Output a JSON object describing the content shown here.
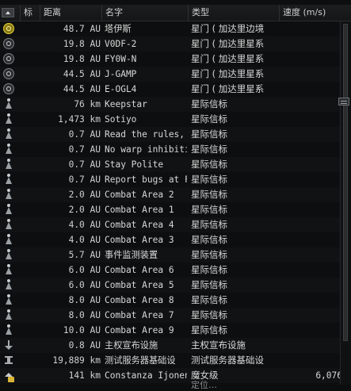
{
  "columns": {
    "icon": "标",
    "distance": "距离",
    "name": "名字",
    "type": "类型",
    "speed": "速度 (m/s)"
  },
  "rows": [
    {
      "icon": "gate-active-icon",
      "distance": "48.7 AU",
      "name": "塔伊斯",
      "type": "星门 ( 加达里边境",
      "speed": ""
    },
    {
      "icon": "gate-icon",
      "distance": "19.8 AU",
      "name": "V0DF-2",
      "type": "星门 ( 加达里星系",
      "speed": ""
    },
    {
      "icon": "gate-icon",
      "distance": "19.8 AU",
      "name": "FY0W-N",
      "type": "星门 ( 加达里星系",
      "speed": ""
    },
    {
      "icon": "gate-icon",
      "distance": "44.5 AU",
      "name": "J-GAMP",
      "type": "星门 ( 加达里星系",
      "speed": ""
    },
    {
      "icon": "gate-icon",
      "distance": "44.5 AU",
      "name": "E-OGL4",
      "type": "星门 ( 加达里星系",
      "speed": ""
    },
    {
      "icon": "beacon-icon",
      "distance": "76 km",
      "name": "Keepstar",
      "type": "星际信标",
      "speed": ""
    },
    {
      "icon": "beacon-icon",
      "distance": "1,473 km",
      "name": "Sotiyo",
      "type": "星际信标",
      "speed": ""
    },
    {
      "icon": "beacon-icon",
      "distance": "0.7 AU",
      "name": "Read the rules, t",
      "type": "星际信标",
      "speed": ""
    },
    {
      "icon": "beacon-icon",
      "distance": "0.7 AU",
      "name": "No warp inhibiting",
      "type": "星际信标",
      "speed": ""
    },
    {
      "icon": "beacon-icon",
      "distance": "0.7 AU",
      "name": "Stay Polite",
      "type": "星际信标",
      "speed": ""
    },
    {
      "icon": "beacon-icon",
      "distance": "0.7 AU",
      "name": "Report bugs at F",
      "type": "星际信标",
      "speed": ""
    },
    {
      "icon": "beacon-icon",
      "distance": "2.0 AU",
      "name": "Combat Area 2",
      "type": "星际信标",
      "speed": ""
    },
    {
      "icon": "beacon-icon",
      "distance": "2.0 AU",
      "name": "Combat Area 1",
      "type": "星际信标",
      "speed": ""
    },
    {
      "icon": "beacon-icon",
      "distance": "4.0 AU",
      "name": "Combat Area 4",
      "type": "星际信标",
      "speed": ""
    },
    {
      "icon": "beacon-icon",
      "distance": "4.0 AU",
      "name": "Combat Area 3",
      "type": "星际信标",
      "speed": ""
    },
    {
      "icon": "beacon-icon",
      "distance": "5.7 AU",
      "name": "事件监测装置",
      "type": "星际信标",
      "speed": ""
    },
    {
      "icon": "beacon-icon",
      "distance": "6.0 AU",
      "name": "Combat Area 6",
      "type": "星际信标",
      "speed": ""
    },
    {
      "icon": "beacon-icon",
      "distance": "6.0 AU",
      "name": "Combat Area 5",
      "type": "星际信标",
      "speed": ""
    },
    {
      "icon": "beacon-icon",
      "distance": "8.0 AU",
      "name": "Combat Area 8",
      "type": "星际信标",
      "speed": ""
    },
    {
      "icon": "beacon-icon",
      "distance": "8.0 AU",
      "name": "Combat Area 7",
      "type": "星际信标",
      "speed": ""
    },
    {
      "icon": "beacon-icon",
      "distance": "10.0 AU",
      "name": "Combat Area 9",
      "type": "星际信标",
      "speed": ""
    },
    {
      "icon": "structure-icon",
      "distance": "0.8 AU",
      "name": "主权宣布设施",
      "type": "主权宣布设施",
      "speed": ""
    },
    {
      "icon": "server-icon",
      "distance": "19,889 km",
      "name": "测试服务器基础设",
      "type": "测试服务器基础设",
      "speed": ""
    },
    {
      "icon": "ship-icon",
      "distance": "141 km",
      "name": "Constanza Ijonen",
      "type": "魔女级",
      "speed": "6,076"
    }
  ],
  "partial_row_text": "定位…"
}
